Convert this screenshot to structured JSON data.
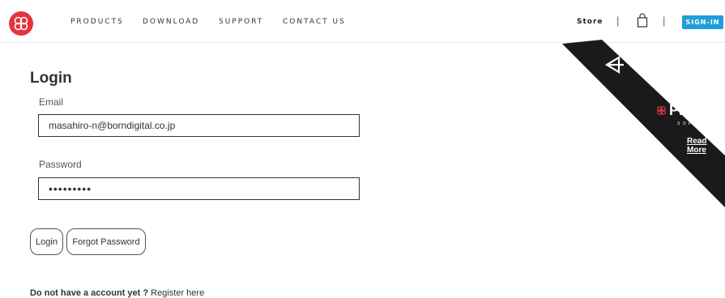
{
  "header": {
    "nav": [
      "PRODUCTS",
      "DOWNLOAD",
      "SUPPORT",
      "CONTACT US"
    ],
    "store_label": "Store",
    "separator": "|",
    "signin_label": "SIGN-IN",
    "brand_color": "#e5343d",
    "signin_color": "#1f9fd9"
  },
  "banner": {
    "unity_label": "unity",
    "ampersand": "&",
    "pixyz_label": "PiXYZ",
    "software_label": "S O F T W A R E",
    "read_more": "Read More"
  },
  "login": {
    "title": "Login",
    "email_label": "Email",
    "email_value": "masahiro-n@borndigital.co.jp",
    "password_label": "Password",
    "password_value": "•••••••••",
    "login_button": "Login",
    "forgot_button": "Forgot Password",
    "no_account": "Do not have a account yet ?",
    "register_link": "Register here"
  }
}
